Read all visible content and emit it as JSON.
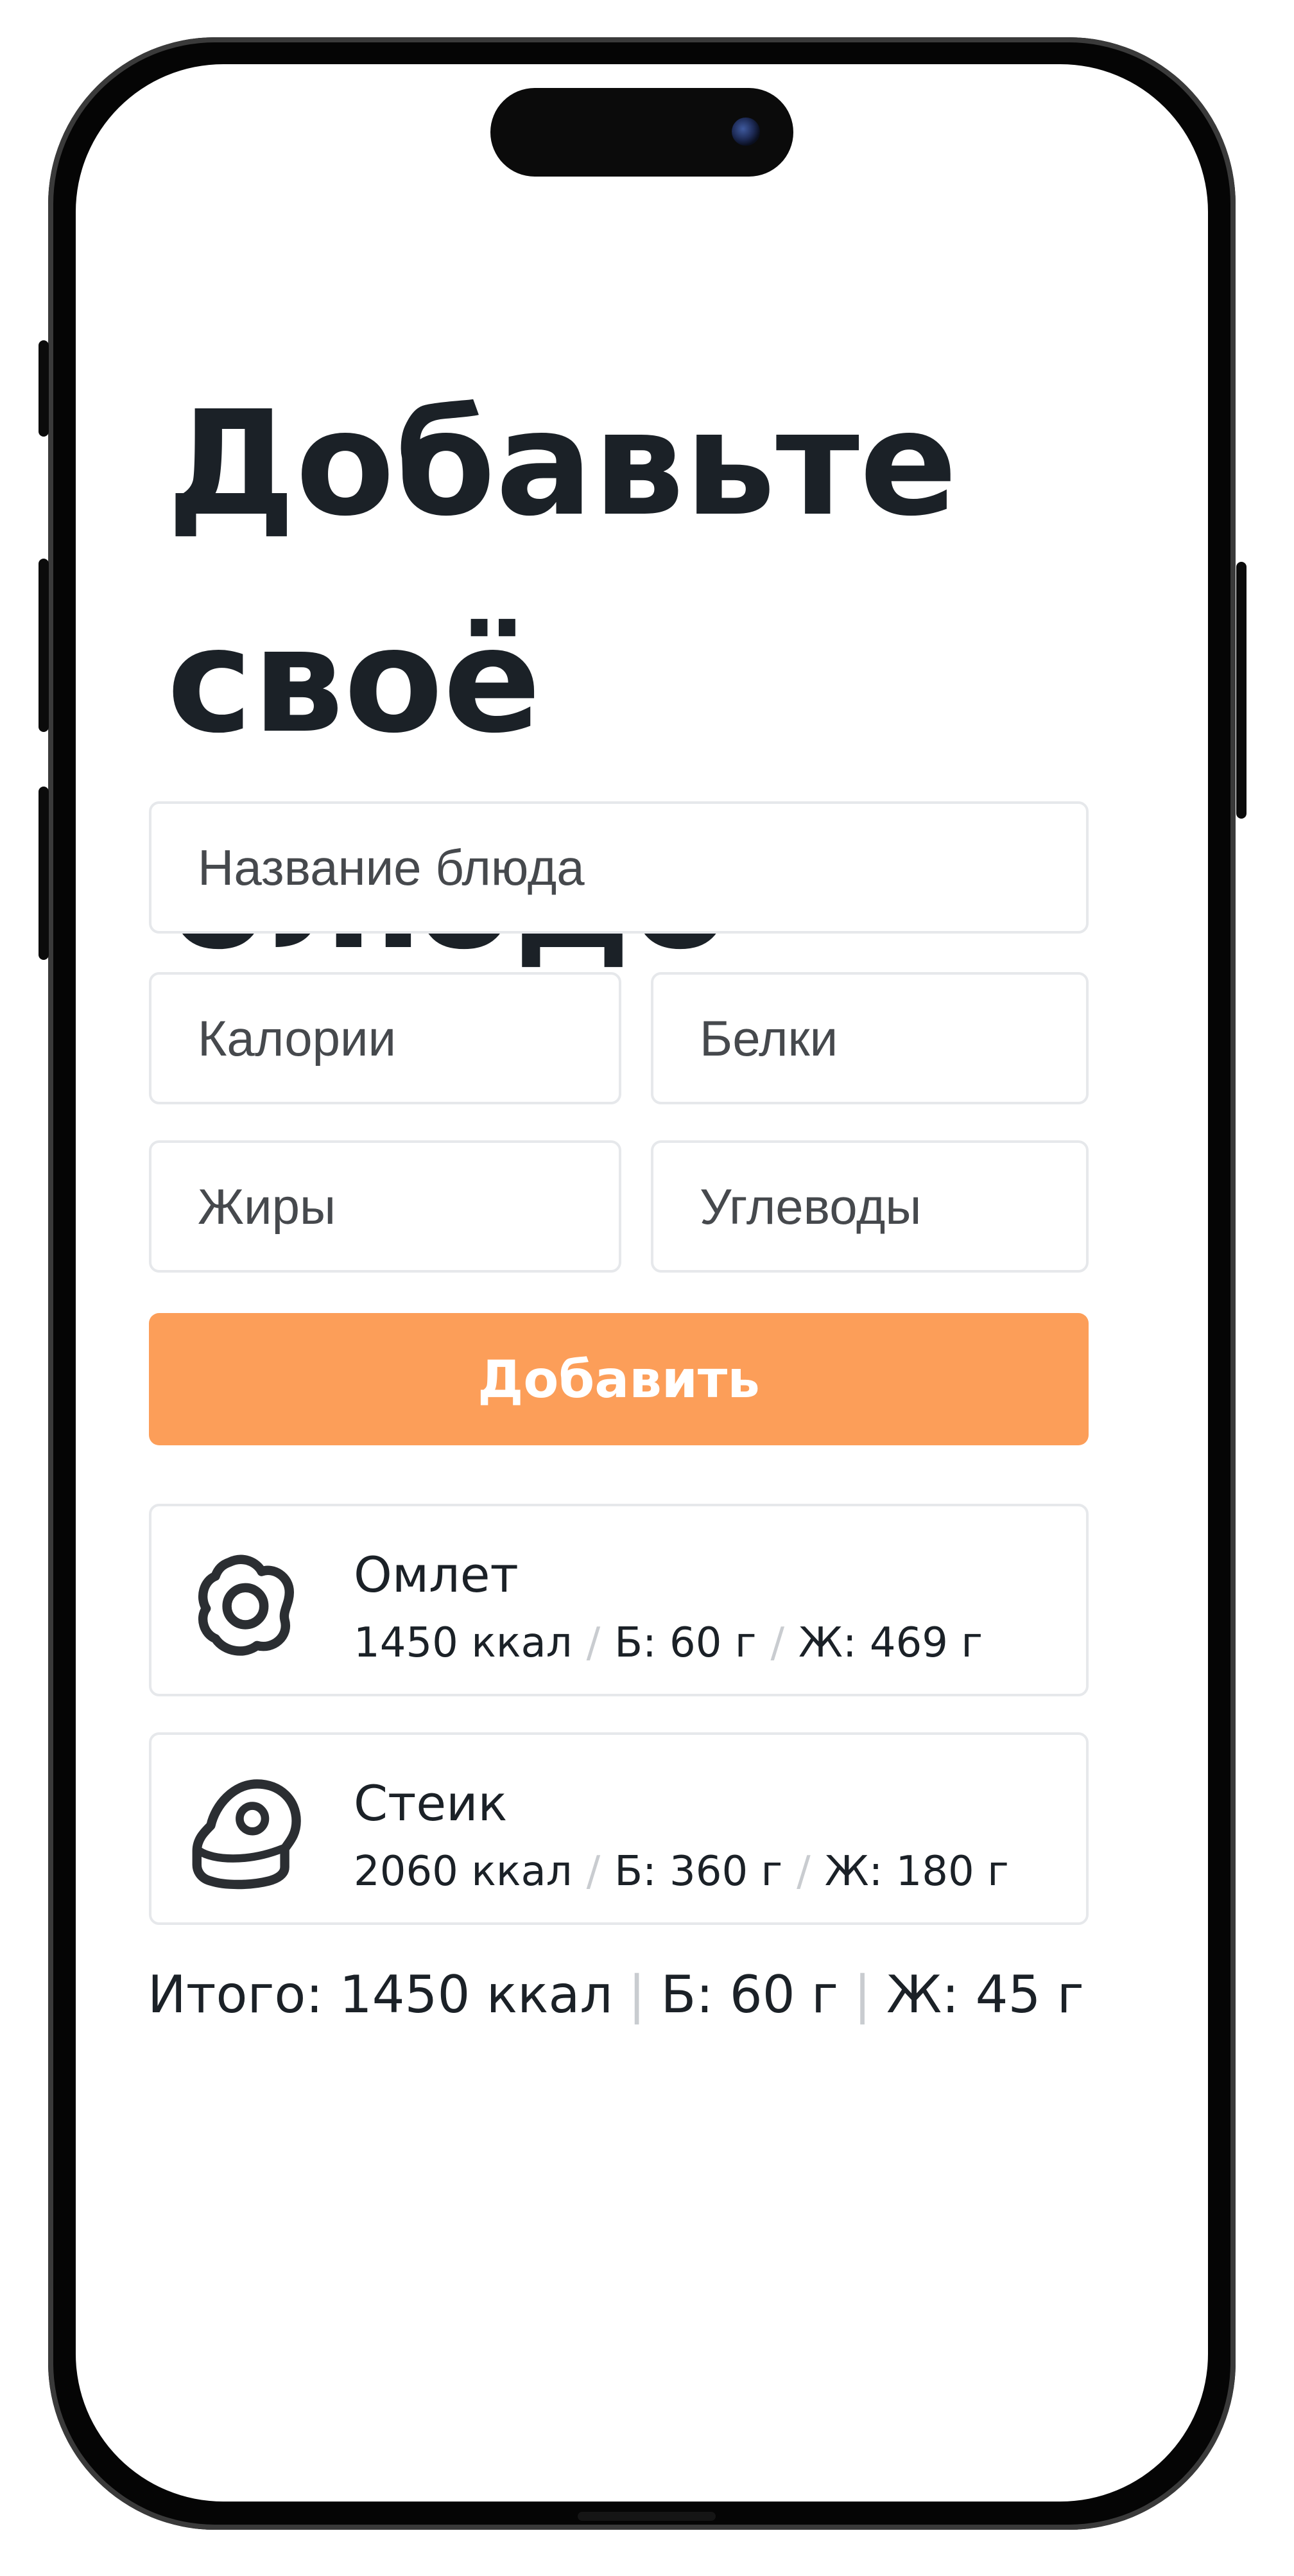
{
  "title": {
    "line1": "Добавьте",
    "line2": "своё блюдо"
  },
  "form": {
    "name_placeholder": "Название блюда",
    "calories_placeholder": "Калории",
    "protein_placeholder": "Белки",
    "fat_placeholder": "Жиры",
    "carbs_placeholder": "Углеводы",
    "add_button_label": "Добавить"
  },
  "dishes": [
    {
      "name": "Омлет",
      "icon": "fried-egg-icon",
      "calories": "1450 ккал",
      "protein": "Б: 60 г",
      "fat": "Ж: 469 г"
    },
    {
      "name": "Стеик",
      "icon": "steak-icon",
      "calories": "2060 ккал",
      "protein": "Б: 360 г",
      "fat": "Ж: 180 г"
    }
  ],
  "totals": {
    "calories": "Итого: 1450 ккал",
    "protein": "Б: 60 г",
    "fat": "Ж: 45 г"
  },
  "colors": {
    "accent": "#fc9e59",
    "text": "#1b2127",
    "border": "#e6e8eb"
  }
}
